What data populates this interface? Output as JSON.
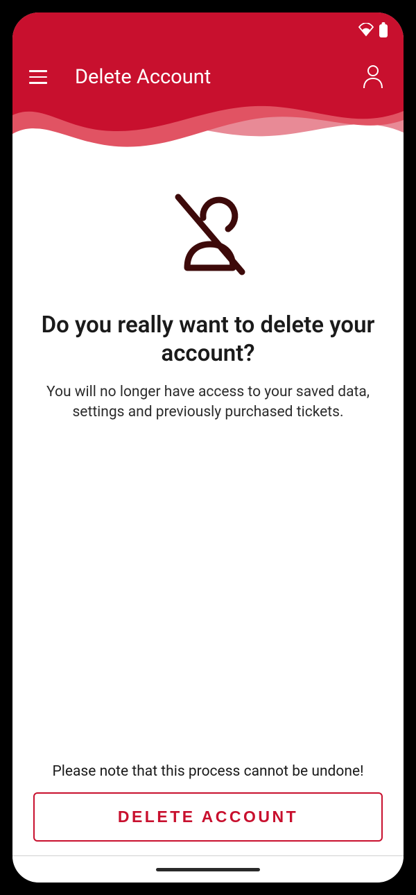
{
  "header": {
    "title": "Delete Account"
  },
  "content": {
    "heading": "Do you really want to delete your account?",
    "subtext": "You will no longer have access to your saved data, settings and previously purchased tickets."
  },
  "footer": {
    "warning": "Please note that this process cannot be undone!",
    "delete_button_label": "DELETE ACCOUNT"
  },
  "colors": {
    "primary": "#c8102e",
    "icon_dark": "#3d0a0a"
  }
}
